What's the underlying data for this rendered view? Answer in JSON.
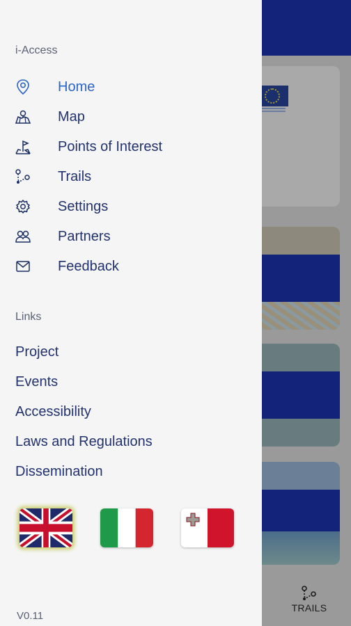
{
  "drawer": {
    "header_label": "i-Access",
    "nav_items": [
      {
        "label": "Home",
        "icon": "map-pin-icon",
        "active": true
      },
      {
        "label": "Map",
        "icon": "map-icon",
        "active": false
      },
      {
        "label": "Points of Interest",
        "icon": "flag-marker-icon",
        "active": false
      },
      {
        "label": "Trails",
        "icon": "trail-route-icon",
        "active": false
      },
      {
        "label": "Settings",
        "icon": "gear-icon",
        "active": false
      },
      {
        "label": "Partners",
        "icon": "people-icon",
        "active": false
      },
      {
        "label": "Feedback",
        "icon": "envelope-icon",
        "active": false
      }
    ],
    "links_label": "Links",
    "links": [
      "Project",
      "Events",
      "Accessibility",
      "Laws and Regulations",
      "Dissemination"
    ],
    "languages": [
      {
        "name": "English",
        "flag": "uk-flag",
        "selected": true
      },
      {
        "name": "Italian",
        "flag": "italy-flag",
        "selected": false
      },
      {
        "name": "Maltese",
        "flag": "malta-flag",
        "selected": false
      }
    ],
    "version": "V0.11"
  },
  "background": {
    "bottom_nav_trails_label": "TRAILS"
  },
  "colors": {
    "header_blue": "#13237a",
    "active_item": "#2c64c8",
    "nav_text": "#22326e"
  }
}
